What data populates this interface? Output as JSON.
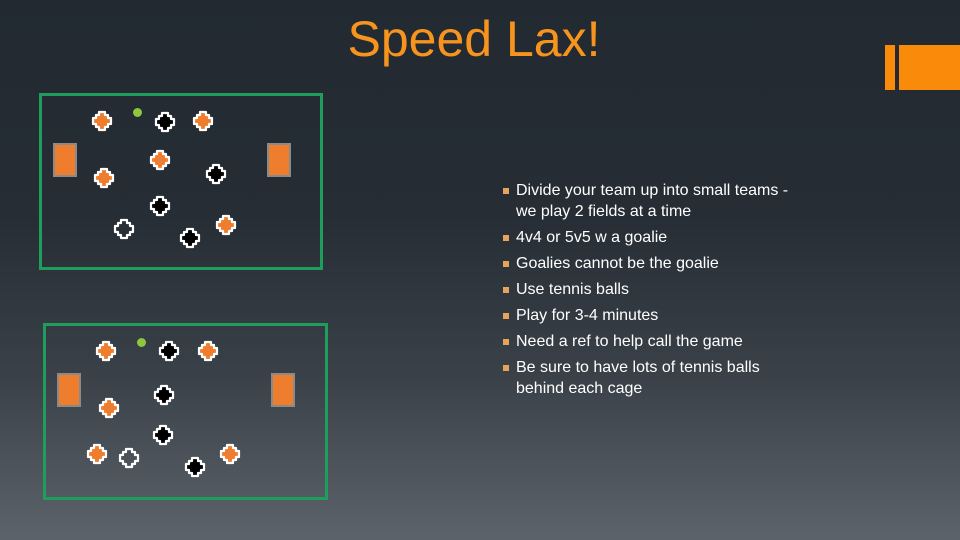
{
  "slide": {
    "title": "Speed Lax!",
    "colors": {
      "title": "#f7941d",
      "accent": "#fa8a0a",
      "field_line": "#1e9e5a",
      "goal": "#ee7d2e",
      "team_orange": "#ee7d2e",
      "team_black": "#000000",
      "ball": "#8dc63f",
      "bullet_marker": "#e8a35a"
    },
    "bullets": [
      "Divide your team up into small teams - we play 2 fields at a time",
      "4v4 or 5v5 w a goalie",
      "Goalies cannot be the goalie",
      "Use tennis balls",
      "Play for 3-4 minutes",
      "Need a ref to help call the game",
      "Be sure to have lots of tennis balls behind each cage"
    ]
  },
  "fields": [
    {
      "name": "field-1",
      "goals": 2,
      "players": [
        {
          "team": "orange"
        },
        {
          "team": "black"
        },
        {
          "team": "orange"
        },
        {
          "team": "orange"
        },
        {
          "team": "orange"
        },
        {
          "team": "black"
        },
        {
          "team": "black"
        },
        {
          "team": "outline"
        },
        {
          "team": "black"
        },
        {
          "team": "orange"
        }
      ],
      "balls": 1
    },
    {
      "name": "field-2",
      "goals": 2,
      "players": [
        {
          "team": "orange"
        },
        {
          "team": "black"
        },
        {
          "team": "orange"
        },
        {
          "team": "black"
        },
        {
          "team": "orange"
        },
        {
          "team": "black"
        },
        {
          "team": "orange"
        },
        {
          "team": "outline"
        },
        {
          "team": "black"
        },
        {
          "team": "orange"
        }
      ],
      "balls": 1
    }
  ]
}
